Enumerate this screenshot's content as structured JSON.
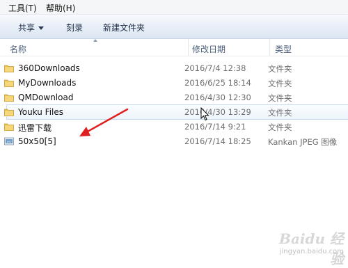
{
  "menu": {
    "items": [
      "工具(T)",
      "帮助(H)"
    ]
  },
  "toolbar": {
    "share_label": "共享",
    "burn_label": "刻录",
    "new_folder_label": "新建文件夹"
  },
  "columns": {
    "name": "名称",
    "date": "修改日期",
    "type": "类型"
  },
  "files": [
    {
      "name": "360Downloads",
      "date": "2016/7/4 12:38",
      "type": "文件夹",
      "icon": "folder-icon"
    },
    {
      "name": "MyDownloads",
      "date": "2016/6/25 18:14",
      "type": "文件夹",
      "icon": "folder-icon"
    },
    {
      "name": "QMDownload",
      "date": "2016/4/30 12:30",
      "type": "文件夹",
      "icon": "folder-icon"
    },
    {
      "name": "Youku Files",
      "date": "2016/4/30 13:29",
      "type": "文件夹",
      "icon": "folder-icon",
      "hovered": true
    },
    {
      "name": "迅雷下载",
      "date": "2016/7/14 9:21",
      "type": "文件夹",
      "icon": "folder-icon"
    },
    {
      "name": "50x50[5]",
      "date": "2016/7/14 18:25",
      "type": "Kankan JPEG 图像",
      "icon": "jpeg-file-icon"
    }
  ],
  "annotation": {
    "color": "#e02020"
  },
  "watermark": {
    "logo_text": "Baidu 经验",
    "url": "jingyan.baidu.com"
  }
}
